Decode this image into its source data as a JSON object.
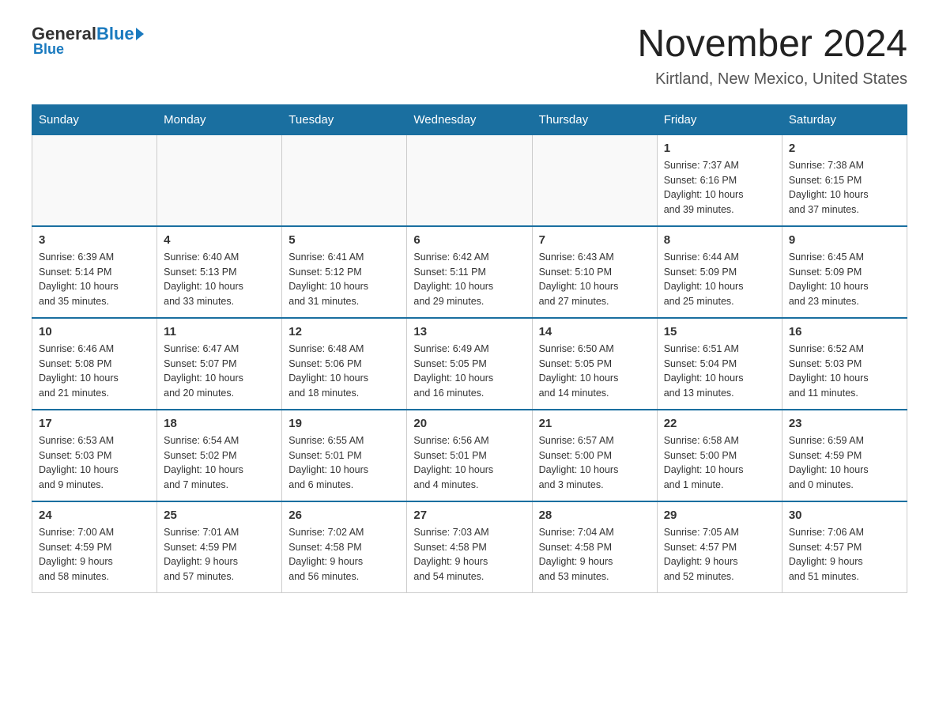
{
  "logo": {
    "text_general": "General",
    "text_blue": "Blue"
  },
  "header": {
    "month_title": "November 2024",
    "location": "Kirtland, New Mexico, United States"
  },
  "weekdays": [
    "Sunday",
    "Monday",
    "Tuesday",
    "Wednesday",
    "Thursday",
    "Friday",
    "Saturday"
  ],
  "weeks": [
    [
      {
        "day": "",
        "info": ""
      },
      {
        "day": "",
        "info": ""
      },
      {
        "day": "",
        "info": ""
      },
      {
        "day": "",
        "info": ""
      },
      {
        "day": "",
        "info": ""
      },
      {
        "day": "1",
        "info": "Sunrise: 7:37 AM\nSunset: 6:16 PM\nDaylight: 10 hours\nand 39 minutes."
      },
      {
        "day": "2",
        "info": "Sunrise: 7:38 AM\nSunset: 6:15 PM\nDaylight: 10 hours\nand 37 minutes."
      }
    ],
    [
      {
        "day": "3",
        "info": "Sunrise: 6:39 AM\nSunset: 5:14 PM\nDaylight: 10 hours\nand 35 minutes."
      },
      {
        "day": "4",
        "info": "Sunrise: 6:40 AM\nSunset: 5:13 PM\nDaylight: 10 hours\nand 33 minutes."
      },
      {
        "day": "5",
        "info": "Sunrise: 6:41 AM\nSunset: 5:12 PM\nDaylight: 10 hours\nand 31 minutes."
      },
      {
        "day": "6",
        "info": "Sunrise: 6:42 AM\nSunset: 5:11 PM\nDaylight: 10 hours\nand 29 minutes."
      },
      {
        "day": "7",
        "info": "Sunrise: 6:43 AM\nSunset: 5:10 PM\nDaylight: 10 hours\nand 27 minutes."
      },
      {
        "day": "8",
        "info": "Sunrise: 6:44 AM\nSunset: 5:09 PM\nDaylight: 10 hours\nand 25 minutes."
      },
      {
        "day": "9",
        "info": "Sunrise: 6:45 AM\nSunset: 5:09 PM\nDaylight: 10 hours\nand 23 minutes."
      }
    ],
    [
      {
        "day": "10",
        "info": "Sunrise: 6:46 AM\nSunset: 5:08 PM\nDaylight: 10 hours\nand 21 minutes."
      },
      {
        "day": "11",
        "info": "Sunrise: 6:47 AM\nSunset: 5:07 PM\nDaylight: 10 hours\nand 20 minutes."
      },
      {
        "day": "12",
        "info": "Sunrise: 6:48 AM\nSunset: 5:06 PM\nDaylight: 10 hours\nand 18 minutes."
      },
      {
        "day": "13",
        "info": "Sunrise: 6:49 AM\nSunset: 5:05 PM\nDaylight: 10 hours\nand 16 minutes."
      },
      {
        "day": "14",
        "info": "Sunrise: 6:50 AM\nSunset: 5:05 PM\nDaylight: 10 hours\nand 14 minutes."
      },
      {
        "day": "15",
        "info": "Sunrise: 6:51 AM\nSunset: 5:04 PM\nDaylight: 10 hours\nand 13 minutes."
      },
      {
        "day": "16",
        "info": "Sunrise: 6:52 AM\nSunset: 5:03 PM\nDaylight: 10 hours\nand 11 minutes."
      }
    ],
    [
      {
        "day": "17",
        "info": "Sunrise: 6:53 AM\nSunset: 5:03 PM\nDaylight: 10 hours\nand 9 minutes."
      },
      {
        "day": "18",
        "info": "Sunrise: 6:54 AM\nSunset: 5:02 PM\nDaylight: 10 hours\nand 7 minutes."
      },
      {
        "day": "19",
        "info": "Sunrise: 6:55 AM\nSunset: 5:01 PM\nDaylight: 10 hours\nand 6 minutes."
      },
      {
        "day": "20",
        "info": "Sunrise: 6:56 AM\nSunset: 5:01 PM\nDaylight: 10 hours\nand 4 minutes."
      },
      {
        "day": "21",
        "info": "Sunrise: 6:57 AM\nSunset: 5:00 PM\nDaylight: 10 hours\nand 3 minutes."
      },
      {
        "day": "22",
        "info": "Sunrise: 6:58 AM\nSunset: 5:00 PM\nDaylight: 10 hours\nand 1 minute."
      },
      {
        "day": "23",
        "info": "Sunrise: 6:59 AM\nSunset: 4:59 PM\nDaylight: 10 hours\nand 0 minutes."
      }
    ],
    [
      {
        "day": "24",
        "info": "Sunrise: 7:00 AM\nSunset: 4:59 PM\nDaylight: 9 hours\nand 58 minutes."
      },
      {
        "day": "25",
        "info": "Sunrise: 7:01 AM\nSunset: 4:59 PM\nDaylight: 9 hours\nand 57 minutes."
      },
      {
        "day": "26",
        "info": "Sunrise: 7:02 AM\nSunset: 4:58 PM\nDaylight: 9 hours\nand 56 minutes."
      },
      {
        "day": "27",
        "info": "Sunrise: 7:03 AM\nSunset: 4:58 PM\nDaylight: 9 hours\nand 54 minutes."
      },
      {
        "day": "28",
        "info": "Sunrise: 7:04 AM\nSunset: 4:58 PM\nDaylight: 9 hours\nand 53 minutes."
      },
      {
        "day": "29",
        "info": "Sunrise: 7:05 AM\nSunset: 4:57 PM\nDaylight: 9 hours\nand 52 minutes."
      },
      {
        "day": "30",
        "info": "Sunrise: 7:06 AM\nSunset: 4:57 PM\nDaylight: 9 hours\nand 51 minutes."
      }
    ]
  ]
}
